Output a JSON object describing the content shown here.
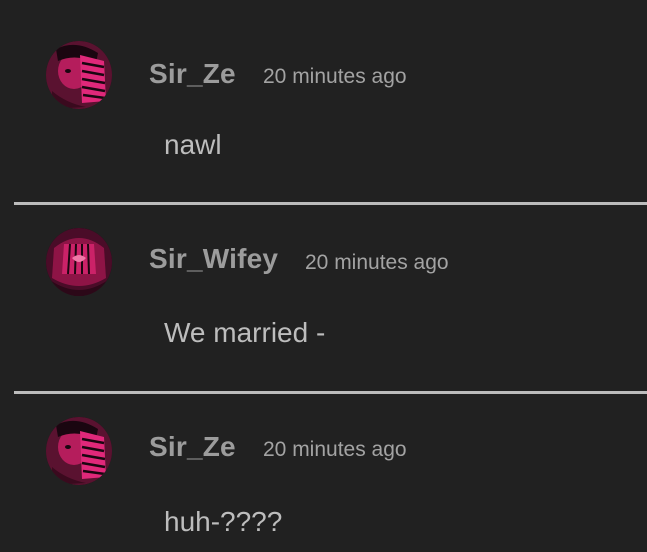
{
  "comments": [
    {
      "username": "Sir_Ze",
      "timestamp": "20 minutes ago",
      "message": "nawl",
      "avatar_icon": "user-avatar-sir-ze"
    },
    {
      "username": "Sir_Wifey",
      "timestamp": "20 minutes ago",
      "message": "We married -",
      "avatar_icon": "user-avatar-sir-wifey"
    },
    {
      "username": "Sir_Ze",
      "timestamp": "20 minutes ago",
      "message": "huh-????",
      "avatar_icon": "user-avatar-sir-ze"
    }
  ],
  "colors": {
    "background": "#212121",
    "username": "#9c9c9c",
    "timestamp": "#a3a3a3",
    "message": "#bdbdbd",
    "divider": "#bcbcbc",
    "avatar_accent": "#d6246e"
  }
}
